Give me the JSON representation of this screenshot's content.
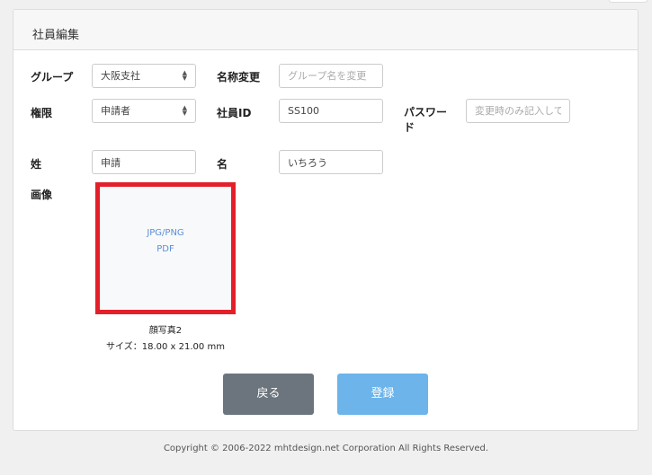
{
  "page": {
    "title": "社員編集"
  },
  "form": {
    "group": {
      "label": "グループ",
      "value": "大阪支社"
    },
    "rename": {
      "label": "名称変更",
      "placeholder": "グループ名を変更"
    },
    "role": {
      "label": "権限",
      "value": "申請者"
    },
    "employee_id": {
      "label": "社員ID",
      "value": "SS100"
    },
    "password": {
      "label": "パスワード",
      "placeholder": "変更時のみ記入して"
    },
    "last_name": {
      "label": "姓",
      "value": "申請"
    },
    "first_name": {
      "label": "名",
      "value": "いちろう"
    },
    "image": {
      "label": "画像",
      "formats_line1": "JPG/PNG",
      "formats_line2": "PDF",
      "caption": "顔写真2",
      "size": "サイズ：18.00 x 21.00 mm"
    }
  },
  "buttons": {
    "back": "戻る",
    "register": "登録"
  },
  "footer": {
    "copyright": "Copyright © 2006-2022 mhtdesign.net Corporation All Rights Reserved."
  },
  "colors": {
    "highlight": "#e3202a",
    "back_button": "#6c757d",
    "register_button": "#6cb4ea"
  }
}
